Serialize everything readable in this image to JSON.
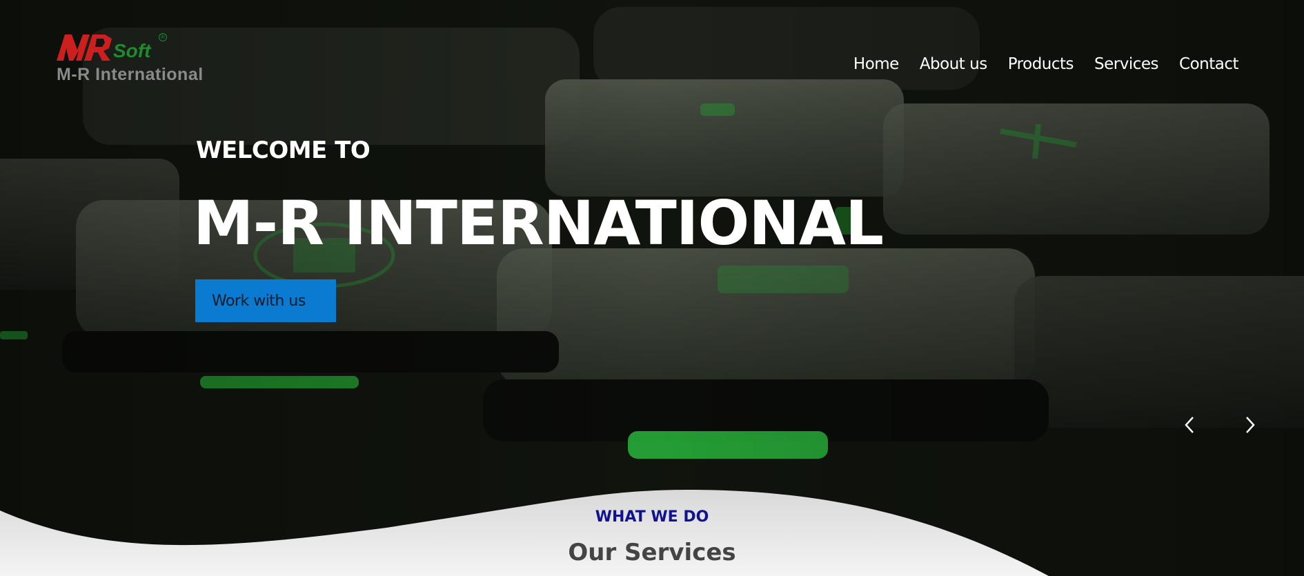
{
  "brand": {
    "logo_mark": "MR",
    "logo_suffix": "Soft",
    "logo_registered": "®",
    "name": "M-R International",
    "colors": {
      "logo_red": "#cc1f1f",
      "logo_green": "#1f8a2e",
      "logo_gray": "#8a8a8a"
    }
  },
  "nav": {
    "items": [
      {
        "label": "Home"
      },
      {
        "label": "About us"
      },
      {
        "label": "Products"
      },
      {
        "label": "Services"
      },
      {
        "label": "Contact"
      }
    ]
  },
  "hero": {
    "kicker": "WELCOME TO",
    "headline": "M-R INTERNATIONAL",
    "cta_label": "Work with us",
    "background_image": "dark keyboard keys with green backlight",
    "prev_icon": "chevron-left-icon",
    "next_icon": "chevron-right-icon",
    "colors": {
      "cta_bg": "#0a7bd1",
      "text": "#ffffff"
    }
  },
  "services": {
    "kicker": "WHAT WE DO",
    "title": "Our Services",
    "colors": {
      "kicker": "#12128f",
      "title": "#444444"
    }
  }
}
